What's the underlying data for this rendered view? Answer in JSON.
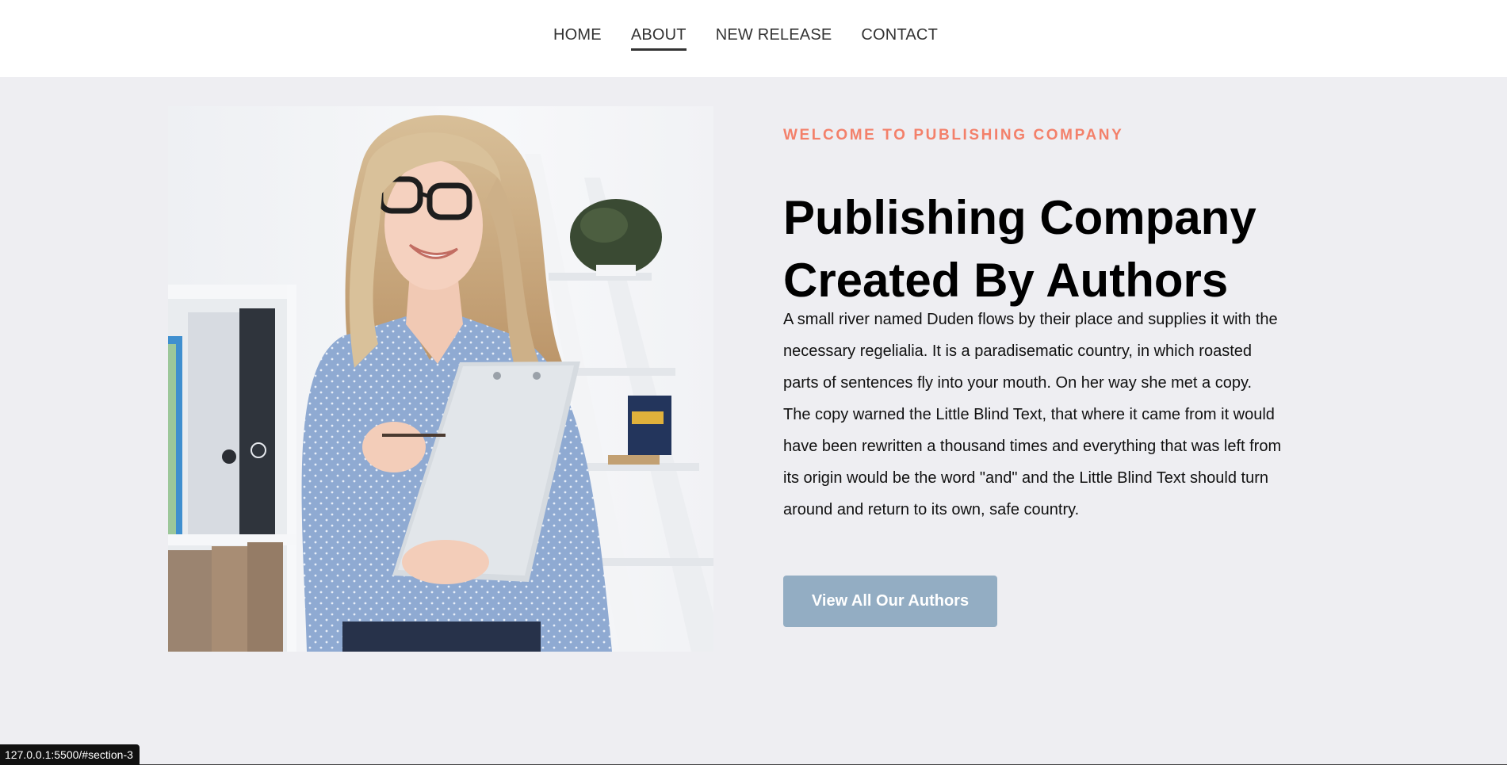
{
  "nav": {
    "items": [
      {
        "label": "HOME",
        "active": false
      },
      {
        "label": "ABOUT",
        "active": true
      },
      {
        "label": "NEW RELEASE",
        "active": false
      },
      {
        "label": "CONTACT",
        "active": false
      }
    ]
  },
  "hero": {
    "eyebrow": "WELCOME TO PUBLISHING COMPANY",
    "title_line1": "Publishing Company",
    "title_line2": "Created By Authors",
    "description": "A small river named Duden flows by their place and supplies it with the necessary regelialia. It is a paradisematic country, in which roasted parts of sentences fly into your mouth. On her way she met a copy. The copy warned the Little Blind Text, that where it came from it would have been rewritten a thousand times and everything that was left from its origin would be the word \"and\" and the Little Blind Text should turn around and return to its own, safe country.",
    "cta_label": "View All Our Authors"
  },
  "status_bar": {
    "url": "127.0.0.1:5500/#section-3"
  },
  "colors": {
    "page_bg": "#eeeef2",
    "accent": "#f3806a",
    "button_bg": "#93adc3"
  }
}
